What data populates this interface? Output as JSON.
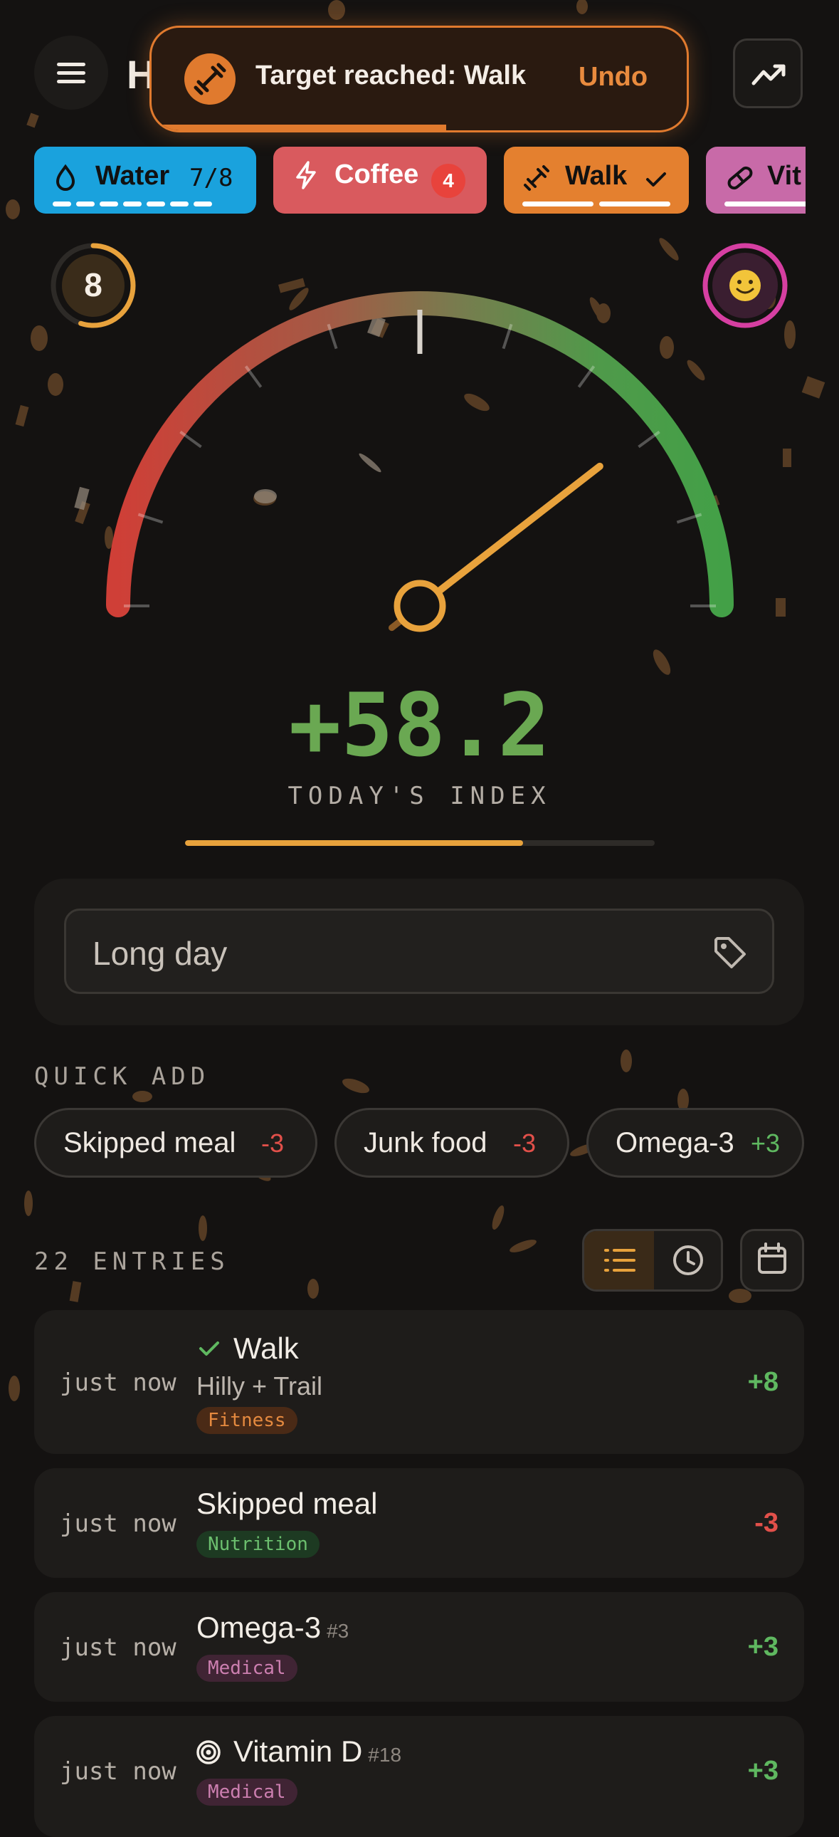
{
  "header": {
    "app_title": "H",
    "menu_icon": "menu-icon",
    "trend_icon": "trending-up-icon"
  },
  "toast": {
    "message": "Target reached: Walk",
    "action": "Undo",
    "icon": "dumbbell-icon",
    "progress": 0.55
  },
  "chips": [
    {
      "icon": "droplet-icon",
      "label": "Water",
      "count": "7/8",
      "color": "#1aa2dd",
      "progress_filled": 7,
      "progress_total": 8
    },
    {
      "icon": "lightning-icon",
      "label": "Coffee",
      "badge": "4",
      "color": "#d95a5e"
    },
    {
      "icon": "dumbbell-icon",
      "label": "Walk",
      "status_icon": "check-icon",
      "color": "#e4802f"
    },
    {
      "icon": "pill-icon",
      "label": "Vit",
      "color": "#c86aa8"
    }
  ],
  "gauge": {
    "left_ring_value": "8",
    "left_ring_progress": 0.55,
    "left_ring_color": "#e8a23c",
    "right_ring_emoji": "🙂",
    "right_ring_color": "#d63fa2",
    "needle_fraction": 0.79,
    "needle_color": "#e8a23c"
  },
  "score": {
    "value": "+58.2",
    "label": "TODAY'S INDEX",
    "progress": 0.72,
    "color": "#6aa852"
  },
  "note": {
    "value": "Long day",
    "tag_icon": "tag-icon"
  },
  "quick_add": {
    "title": "QUICK ADD",
    "items": [
      {
        "label": "Skipped meal",
        "delta": "-3"
      },
      {
        "label": "Junk food",
        "delta": "-3"
      },
      {
        "label": "Omega-3",
        "delta": "+3"
      }
    ]
  },
  "entries_header": {
    "title": "22 ENTRIES",
    "view_icons": [
      "list-icon",
      "clock-icon"
    ],
    "calendar_icon": "calendar-icon"
  },
  "entries": [
    {
      "time": "just now",
      "title": "Walk",
      "title_icon": "check-icon",
      "subtitle": "Hilly + Trail",
      "tag": "Fitness",
      "delta": "+8"
    },
    {
      "time": "just now",
      "title": "Skipped meal",
      "tag": "Nutrition",
      "delta": "-3"
    },
    {
      "time": "just now",
      "title": "Omega-3",
      "number": "#3",
      "tag": "Medical",
      "delta": "+3"
    },
    {
      "time": "just now",
      "title": "Vitamin D",
      "title_icon": "target-icon",
      "number": "#18",
      "tag": "Medical",
      "delta": "+3"
    }
  ]
}
